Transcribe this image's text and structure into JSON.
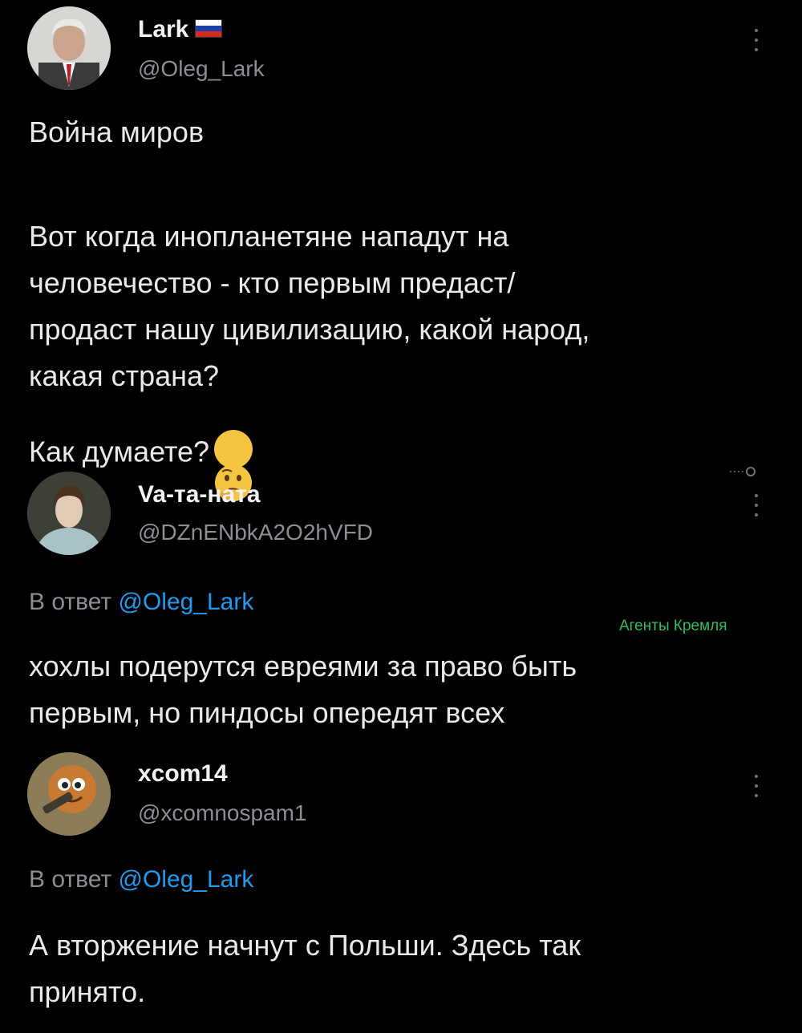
{
  "tweet1": {
    "name": "Lark",
    "handle": "@Oleg_Lark",
    "flag_colors": [
      "#ffffff",
      "#1c3fa8",
      "#d52b1e"
    ],
    "title_line": "Война миров",
    "body": "Вот когда инопланетяне нападут на\nчеловечество - кто первым предаст/\nпродаст нашу цивилизацию, какой народ,\nкакая страна?",
    "question": "Как думаете?",
    "emoji": "thinking-face-icon"
  },
  "tweet2": {
    "name": "Va-та-ната",
    "handle": "@DZnENbkA2O2hVFD",
    "reply_prefix": "В ответ",
    "reply_to": "@Oleg_Lark",
    "body": "хохлы подерутся евреями за право быть\nпервым, но пиндосы опередят всех"
  },
  "tweet3": {
    "name": "xcom14",
    "handle": "@xcomnospam1",
    "reply_prefix": "В ответ",
    "reply_to": "@Oleg_Lark",
    "body": "А вторжение начнут с Польши. Здесь так\nпринято."
  },
  "watermark": "Агенты Кремля",
  "colors": {
    "background": "#000000",
    "text": "#e9e9e9",
    "secondary": "#8b8f94",
    "mention": "#1d9bf0",
    "watermark": "#2fbf5b"
  }
}
